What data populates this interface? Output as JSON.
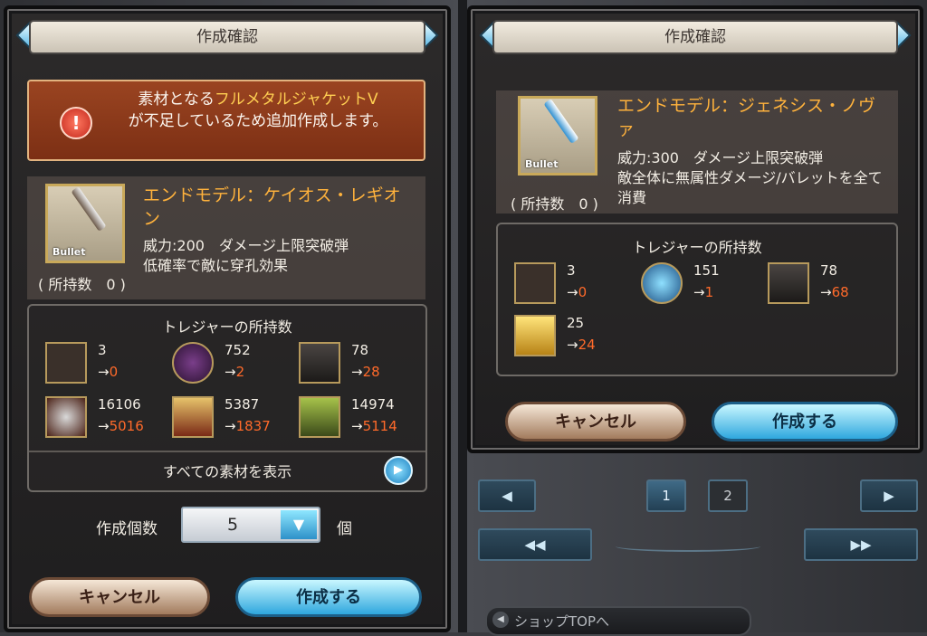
{
  "left": {
    "title": "作成確認",
    "warning": {
      "prefix": "素材となる",
      "highlight": "フルメタルジャケットV",
      "suffix": "が不足しているため追加作成します。"
    },
    "item": {
      "tag": "Bullet",
      "name": "エンドモデル：ケイオス・レギオン",
      "desc_line1": "威力:200　ダメージ上限突破弾",
      "desc_line2": "低確率で敵に穿孔効果",
      "owned": "( 所持数　0 )"
    },
    "treasure_title": "トレジャーの所持数",
    "materials": [
      {
        "icon": "bullet-icon",
        "have": "3",
        "arrow": "→",
        "after": "0"
      },
      {
        "icon": "purple-sword-icon",
        "have": "752",
        "arrow": "→",
        "after": "2"
      },
      {
        "icon": "black-ore-icon",
        "have": "78",
        "arrow": "→",
        "after": "28"
      },
      {
        "icon": "silver-gear-icon",
        "have": "16106",
        "arrow": "→",
        "after": "5016"
      },
      {
        "icon": "red-chest-icon",
        "have": "5387",
        "arrow": "→",
        "after": "1837"
      },
      {
        "icon": "green-box-icon",
        "have": "14974",
        "arrow": "→",
        "after": "5114"
      }
    ],
    "show_all": "すべての素材を表示",
    "quantity_label": "作成個数",
    "quantity_value": "5",
    "quantity_unit": "個",
    "cancel": "キャンセル",
    "confirm": "作成する"
  },
  "right": {
    "title": "作成確認",
    "item": {
      "tag": "Bullet",
      "name": "エンドモデル：ジェネシス・ノヴァ",
      "desc_line1": "威力:300　ダメージ上限突破弾",
      "desc_line2": "敵全体に無属性ダメージ/バレットを全て消費",
      "owned": "( 所持数　0 )"
    },
    "treasure_title": "トレジャーの所持数",
    "materials": [
      {
        "icon": "bullet-icon",
        "have": "3",
        "arrow": "→",
        "after": "0"
      },
      {
        "icon": "blue-crystal-icon",
        "have": "151",
        "arrow": "→",
        "after": "1"
      },
      {
        "icon": "black-ore-icon",
        "have": "78",
        "arrow": "→",
        "after": "68"
      },
      {
        "icon": "gold-bar-icon",
        "have": "25",
        "arrow": "→",
        "after": "24"
      }
    ],
    "cancel": "キャンセル",
    "confirm": "作成する"
  },
  "pager": {
    "prev": "◀",
    "page1": "1",
    "page2": "2",
    "next": "▶",
    "first": "◀◀",
    "last": "▶▶"
  },
  "shop_top": "ショップTOPへ",
  "colors": {
    "accent_orange": "#ffb23c",
    "after_red": "#ff6a2a",
    "confirm_blue": "#2fa7de"
  }
}
